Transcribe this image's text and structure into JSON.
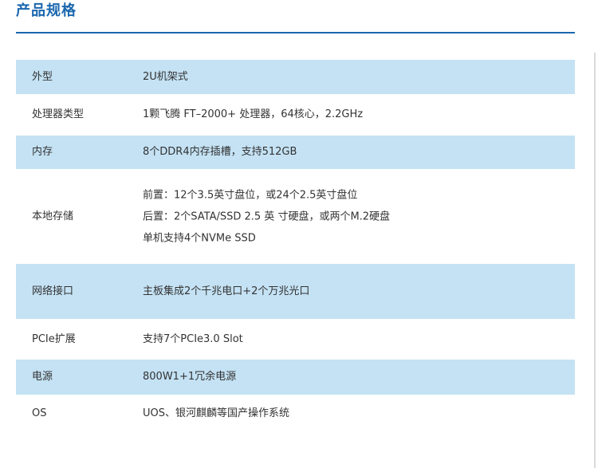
{
  "title": "产品规格",
  "colors": {
    "accent": "#1a67ae",
    "row_shade": "#c4e2f4",
    "text": "#333333"
  },
  "specs": [
    {
      "label": "外型",
      "values": [
        "2U机架式"
      ]
    },
    {
      "label": "处理器类型",
      "values": [
        "1颗飞腾 FT–2000+ 处理器，64核心，2.2GHz"
      ]
    },
    {
      "label": "内存",
      "values": [
        "8个DDR4内存插槽，支持512GB"
      ]
    },
    {
      "label": "本地存储",
      "values": [
        "前置：12个3.5英寸盘位，或24个2.5英寸盘位",
        "后置：2个SATA/SSD 2.5 英 寸硬盘，或两个M.2硬盘",
        "单机支持4个NVMe SSD"
      ]
    },
    {
      "label": "网络接口",
      "values": [
        "主板集成2个千兆电口+2个万兆光口"
      ]
    },
    {
      "label": "PCIe扩展",
      "values": [
        "支持7个PCIe3.0 Slot"
      ]
    },
    {
      "label": "电源",
      "values": [
        "800W1+1冗余电源"
      ]
    },
    {
      "label": "OS",
      "values": [
        "UOS、银河麒麟等国产操作系统"
      ]
    }
  ]
}
